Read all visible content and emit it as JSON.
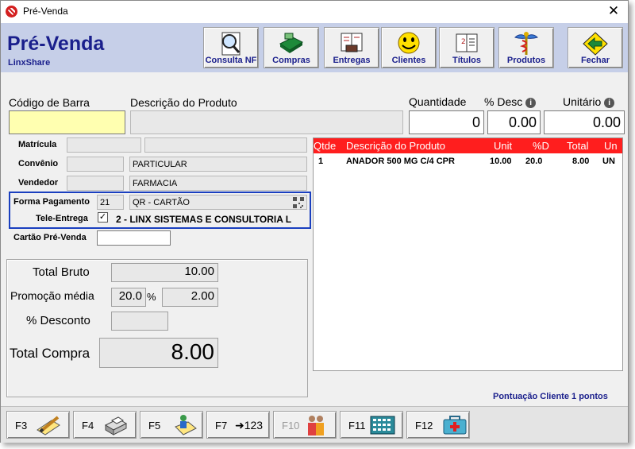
{
  "window": {
    "title": "Pré-Venda",
    "close_glyph": "✕"
  },
  "header": {
    "app_title": "Pré-Venda",
    "subtitle": "LinxShare",
    "buttons": [
      {
        "label": "Consulta NF",
        "icon": "magnifier-document-icon"
      },
      {
        "label": "Compras",
        "icon": "cash-register-icon"
      },
      {
        "label": "Entregas",
        "icon": "delivery-book-icon"
      },
      {
        "label": "Clientes",
        "icon": "smiley-face-icon"
      },
      {
        "label": "Títulos",
        "icon": "titles-book-icon"
      },
      {
        "label": "Produtos",
        "icon": "caduceus-icon"
      },
      {
        "label": "Fechar",
        "icon": "arrow-left-icon"
      }
    ]
  },
  "product_entry": {
    "barcode_label": "Código de Barra",
    "barcode_value": "",
    "description_label": "Descrição do Produto",
    "description_value": "",
    "quantity_label": "Quantidade",
    "quantity_value": "0",
    "discount_label": "% Desc",
    "discount_value": "0.00",
    "unit_label": "Unitário",
    "unit_value": "0.00",
    "info_glyph": "i"
  },
  "customer": {
    "matricula_label": "Matrícula",
    "convenio_label": "Convênio",
    "convenio_value": "PARTICULAR",
    "vendedor_label": "Vendedor",
    "vendedor_value": "FARMACIA",
    "forma_pagamento_label": "Forma Pagamento",
    "forma_pagamento_code": "21",
    "forma_pagamento_value": "QR - CARTÃO",
    "tele_entrega_label": "Tele-Entrega",
    "tele_entrega_checked": true,
    "tele_entrega_value": "2 - LINX SISTEMAS E CONSULTORIA L",
    "cartao_label": "Cartão Pré-Venda",
    "cartao_value": ""
  },
  "totals": {
    "bruto_label": "Total Bruto",
    "bruto_value": "10.00",
    "promocao_label": "Promoção média",
    "promocao_pct": "20.0",
    "promocao_pct_symbol": "%",
    "promocao_value": "2.00",
    "desconto_label": "% Desconto",
    "desconto_value": "",
    "compra_label": "Total Compra",
    "compra_value": "8.00"
  },
  "items_table": {
    "columns": [
      "Qtde",
      "Descrição do Produto",
      "Unit",
      "%D",
      "Total",
      "Un"
    ],
    "rows": [
      [
        "1",
        "ANADOR 500 MG C/4 CPR",
        "10.00",
        "20.0",
        "8.00",
        "UN"
      ]
    ]
  },
  "pontuacao": "Pontuação Cliente 1 pontos",
  "footer": {
    "buttons": [
      {
        "label": "F3",
        "icon": "pencil-paper-icon",
        "enabled": true
      },
      {
        "label": "F4",
        "icon": "printer-icon",
        "enabled": true
      },
      {
        "label": "F5",
        "icon": "person-note-icon",
        "enabled": true
      },
      {
        "label": "F7",
        "icon": "arrow-numbers-icon",
        "glyph": "➜123",
        "enabled": true
      },
      {
        "label": "F10",
        "icon": "people-icon",
        "enabled": false
      },
      {
        "label": "F11",
        "icon": "calculator-icon",
        "enabled": true
      },
      {
        "label": "F12",
        "icon": "medical-kit-icon",
        "enabled": true
      }
    ]
  },
  "colors": {
    "header_bg": "#c6cfe8",
    "title_blue": "#1a1f8c",
    "grid_header": "#ff1e1e",
    "barcode_bg": "#ffffb0",
    "highlight_border": "#1a3fbf"
  }
}
